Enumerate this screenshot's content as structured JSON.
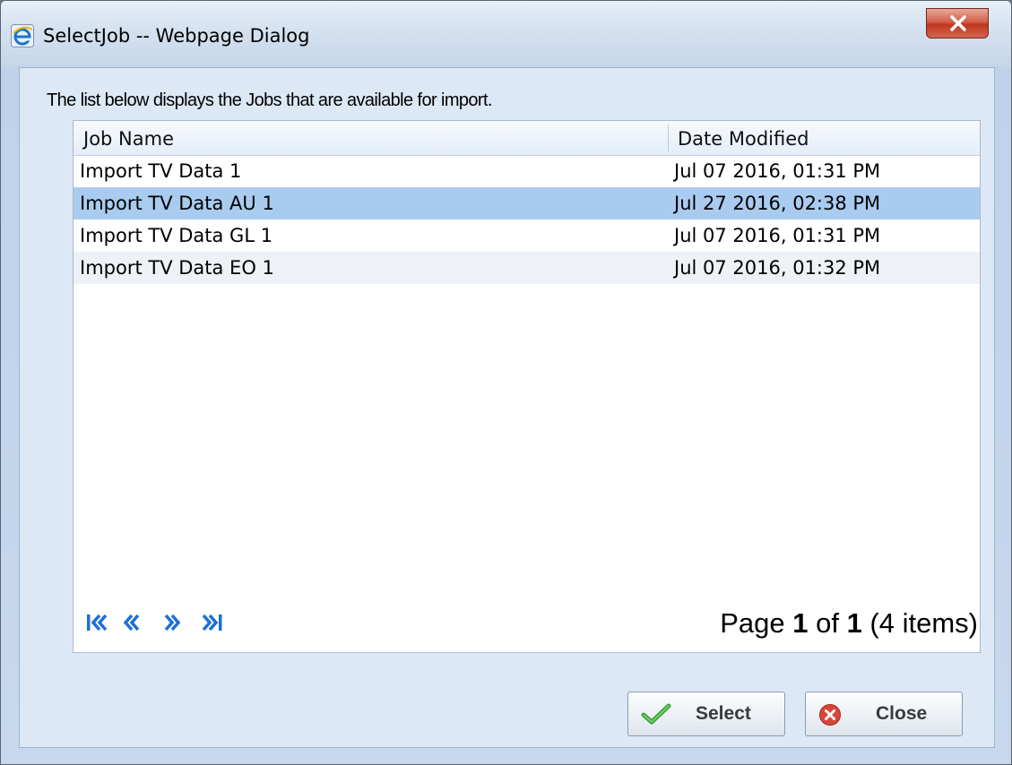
{
  "window": {
    "title": "SelectJob -- Webpage Dialog",
    "close_icon": "close-x-icon"
  },
  "description": "The list below displays the Jobs that are available for import.",
  "grid": {
    "columns": [
      "Job Name",
      "Date Modified"
    ],
    "rows": [
      {
        "job_name": "Import TV Data 1",
        "date_modified": "Jul 07 2016, 01:31 PM",
        "selected": false
      },
      {
        "job_name": "Import TV Data AU 1",
        "date_modified": "Jul 27 2016, 02:38 PM",
        "selected": true
      },
      {
        "job_name": "Import TV Data GL 1",
        "date_modified": "Jul 07 2016, 01:31 PM",
        "selected": false
      },
      {
        "job_name": "Import TV Data EO 1",
        "date_modified": "Jul 07 2016, 01:32 PM",
        "selected": false
      }
    ]
  },
  "pager": {
    "page_label": "Page ",
    "current_page": "1",
    "of_label": " of ",
    "total_pages": "1",
    "items_label": " (4 items)",
    "icons": [
      "first-page-icon",
      "previous-page-icon",
      "next-page-icon",
      "last-page-icon"
    ]
  },
  "buttons": {
    "select_label": "Select",
    "close_label": "Close"
  },
  "colors": {
    "selected_row": "#a9cbef",
    "pager_icon": "#1e6fd6"
  }
}
